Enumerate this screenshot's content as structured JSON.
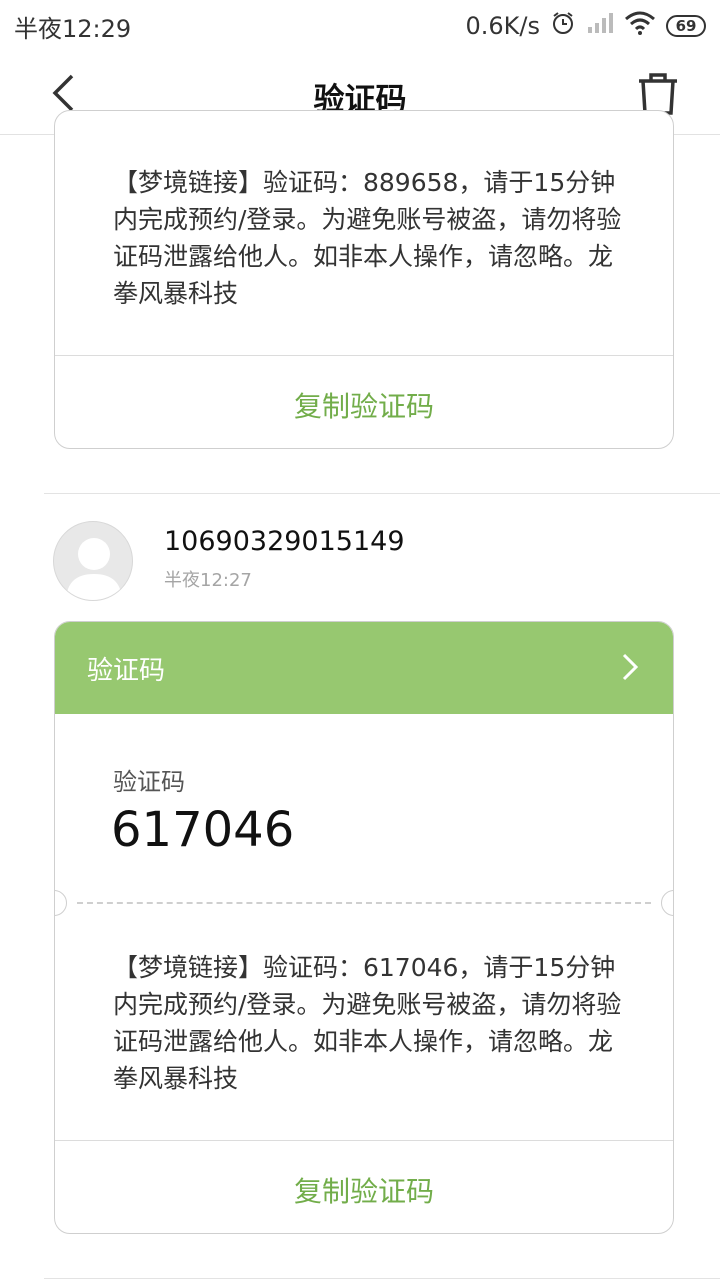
{
  "status_bar": {
    "time": "半夜12:29",
    "net_speed": "0.6K/s",
    "battery": "69",
    "icons": [
      "alarm-icon",
      "signal-icon",
      "wifi-icon",
      "battery-icon"
    ]
  },
  "header": {
    "title": "验证码",
    "back_icon": "back-chevron-icon",
    "delete_icon": "trash-icon"
  },
  "messages": [
    {
      "body": "【梦境链接】验证码：889658，请于15分钟内完成预约/登录。为避免账号被盗，请勿将验证码泄露给他人。如非本人操作，请忽略。龙拳风暴科技",
      "copy_label": "复制验证码"
    },
    {
      "sender": "10690329015149",
      "time": "半夜12:27",
      "card_title": "验证码",
      "code_label": "验证码",
      "code": "617046",
      "body": "【梦境链接】验证码：617046，请于15分钟内完成预约/登录。为避免账号被盗，请勿将验证码泄露给他人。如非本人操作，请忽略。龙拳风暴科技",
      "copy_label": "复制验证码"
    }
  ],
  "colors": {
    "accent_green": "#72ad4a",
    "card_header_green": "#97c870"
  }
}
